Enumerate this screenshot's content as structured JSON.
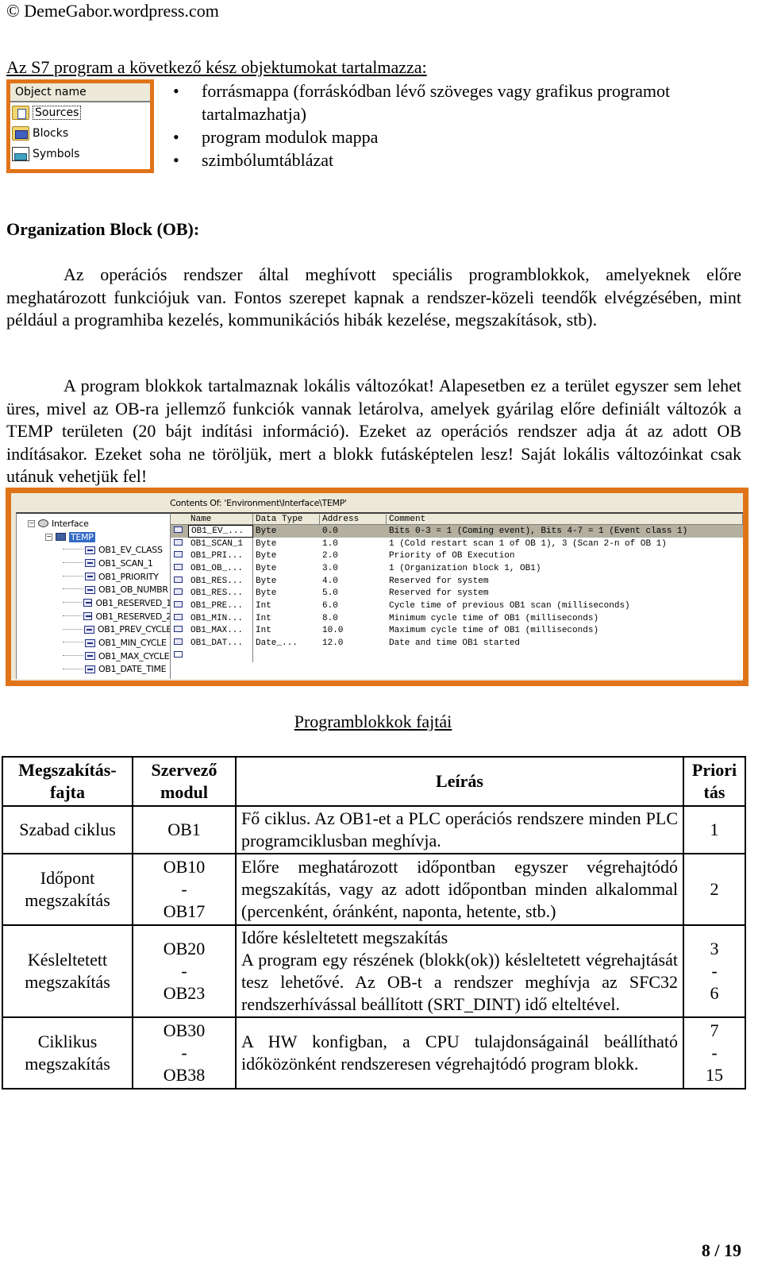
{
  "header": {
    "copyright": "© DemeGabor.wordpress.com"
  },
  "objects_section": {
    "title": "Az S7 program a következő kész objektumokat tartalmazza:",
    "object_list": {
      "header": "Object name",
      "items": [
        {
          "label": "Sources",
          "icon": "source-folder-icon"
        },
        {
          "label": "Blocks",
          "icon": "blocks-folder-icon"
        },
        {
          "label": "Symbols",
          "icon": "symbols-icon"
        }
      ]
    },
    "bullets": [
      "forrásmappa (forráskódban lévő szöveges vagy grafikus programot tartalmazhatja)",
      "program modulok mappa",
      "szimbólumtáblázat"
    ]
  },
  "ob_section": {
    "title": "Organization Block (OB):",
    "paragraph1": "Az operációs rendszer által meghívott speciális programblokkok, amelyeknek előre meghatározott funkciójuk van. Fontos szerepet kapnak a rendszer-közeli teendők elvégzésében, mint például a programhiba kezelés, kommunikációs hibák kezelése, megszakítások, stb).",
    "paragraph2": "A program blokkok tartalmaznak lokális változókat! Alapesetben ez a terület egyszer sem lehet üres, mivel az OB-ra jellemző funkciók vannak letárolva, amelyek gyárilag előre definiált változók a TEMP területen (20 bájt indítási információ). Ezeket az operációs rendszer adja át az adott OB indításakor. Ezeket soha ne töröljük, mert a blokk futásképtelen lesz! Saját lokális változóinkat csak utánuk vehetjük fel!"
  },
  "s7_screenshot": {
    "tree": {
      "root": "Interface",
      "selected": "TEMP",
      "children": [
        "OB1_EV_CLASS",
        "OB1_SCAN_1",
        "OB1_PRIORITY",
        "OB1_OB_NUMBR",
        "OB1_RESERVED_1",
        "OB1_RESERVED_2",
        "OB1_PREV_CYCLE",
        "OB1_MIN_CYCLE",
        "OB1_MAX_CYCLE",
        "OB1_DATE_TIME"
      ]
    },
    "contents_title": "Contents Of: 'Environment\\Interface\\TEMP'",
    "columns": [
      "Name",
      "Data Type",
      "Address",
      "Comment"
    ],
    "rows": [
      {
        "name": "OB1_EV_...",
        "type": "Byte",
        "address": "0.0",
        "comment": "Bits 0-3 = 1 (Coming event), Bits 4-7 = 1 (Event class 1)"
      },
      {
        "name": "OB1_SCAN_1",
        "type": "Byte",
        "address": "1.0",
        "comment": "1 (Cold restart scan 1 of OB 1), 3 (Scan 2-n of OB 1)"
      },
      {
        "name": "OB1_PRI...",
        "type": "Byte",
        "address": "2.0",
        "comment": "Priority of OB Execution"
      },
      {
        "name": "OB1_OB_...",
        "type": "Byte",
        "address": "3.0",
        "comment": "1 (Organization block 1, OB1)"
      },
      {
        "name": "OB1_RES...",
        "type": "Byte",
        "address": "4.0",
        "comment": "Reserved for system"
      },
      {
        "name": "OB1_RES...",
        "type": "Byte",
        "address": "5.0",
        "comment": "Reserved for system"
      },
      {
        "name": "OB1_PRE...",
        "type": "Int",
        "address": "6.0",
        "comment": "Cycle time of previous OB1 scan (milliseconds)"
      },
      {
        "name": "OB1_MIN...",
        "type": "Int",
        "address": "8.0",
        "comment": "Minimum cycle time of OB1 (milliseconds)"
      },
      {
        "name": "OB1_MAX...",
        "type": "Int",
        "address": "10.0",
        "comment": "Maximum cycle time of OB1 (milliseconds)"
      },
      {
        "name": "OB1_DAT...",
        "type": "Date_...",
        "address": "12.0",
        "comment": "Date and time OB1 started"
      }
    ],
    "highlighted_row": 0
  },
  "blocks_table": {
    "title": "Programblokkok fajtái",
    "headers": {
      "type": [
        "Megszakítás-",
        "fajta"
      ],
      "module": [
        "Szervező",
        "modul"
      ],
      "description": "Leírás",
      "priority": [
        "Priori",
        "tás"
      ]
    },
    "rows": [
      {
        "type": [
          "Szabad ciklus"
        ],
        "module": [
          "OB1"
        ],
        "description": [
          "Fő ciklus. Az OB1-et a PLC operációs rendszere minden PLC programciklusban meghívja."
        ],
        "priority": [
          "1"
        ]
      },
      {
        "type": [
          "Időpont",
          "megszakítás"
        ],
        "module": [
          "OB10",
          "-",
          "OB17"
        ],
        "description": [
          "Előre meghatározott időpontban egyszer végrehajtódó megszakítás, vagy az adott időpontban minden alkalommal (percenként, óránként, naponta, hetente, stb.)"
        ],
        "priority": [
          "2"
        ]
      },
      {
        "type": [
          "Késleltetett",
          "megszakítás"
        ],
        "module": [
          "OB20",
          "-",
          "OB23"
        ],
        "description": [
          "Időre késleltetett megszakítás",
          "A program egy részének (blokk(ok)) késleltetett végrehajtását tesz lehetővé. Az OB-t a rendszer meghívja az SFC32 rendszerhívással beállított (SRT_DINT) idő elteltével."
        ],
        "priority": [
          "3",
          "-",
          "6"
        ]
      },
      {
        "type": [
          "Ciklikus",
          "megszakítás"
        ],
        "module": [
          "OB30",
          "-",
          "OB38"
        ],
        "description": [
          "A HW konfigban, a CPU tulajdonságainál beállítható időközönként rendszeresen végrehajtódó program blokk."
        ],
        "priority": [
          "7",
          "-",
          "15"
        ]
      }
    ]
  },
  "footer": {
    "page_number": "8 / 19"
  }
}
